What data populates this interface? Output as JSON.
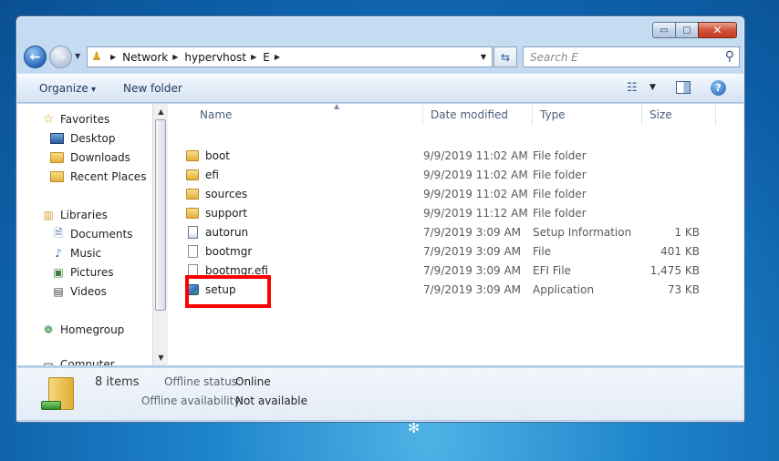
{
  "window": {
    "caption_buttons": {
      "minimize": "▭",
      "maximize": "▢",
      "close": "✕"
    }
  },
  "nav": {
    "back_glyph": "←",
    "forward_glyph": "→",
    "breadcrumbs": [
      "Network",
      "hypervhost",
      "E"
    ],
    "refresh_glyph": "⇆",
    "search_placeholder": "Search E"
  },
  "toolbar": {
    "organize_label": "Organize",
    "new_folder_label": "New folder",
    "views_icon": "views-icon",
    "preview_icon": "preview-pane-icon",
    "help_glyph": "?"
  },
  "sidebar": {
    "favorites": {
      "label": "Favorites",
      "icon": "star-icon"
    },
    "favorite_items": [
      {
        "label": "Desktop",
        "icon": "desktop-icon"
      },
      {
        "label": "Downloads",
        "icon": "downloads-folder-icon"
      },
      {
        "label": "Recent Places",
        "icon": "recent-places-icon"
      }
    ],
    "libraries": {
      "label": "Libraries",
      "icon": "libraries-icon"
    },
    "library_items": [
      {
        "label": "Documents",
        "icon": "documents-icon",
        "glyph": "🗎"
      },
      {
        "label": "Music",
        "icon": "music-icon",
        "glyph": "♪"
      },
      {
        "label": "Pictures",
        "icon": "pictures-icon",
        "glyph": "▣"
      },
      {
        "label": "Videos",
        "icon": "videos-icon",
        "glyph": "▤"
      }
    ],
    "homegroup": {
      "label": "Homegroup",
      "icon": "homegroup-icon",
      "glyph": "❁"
    },
    "computer": {
      "label": "Computer",
      "icon": "computer-icon"
    }
  },
  "columns": {
    "name": "Name",
    "date": "Date modified",
    "type": "Type",
    "size": "Size"
  },
  "files": [
    {
      "name": "boot",
      "date": "9/9/2019 11:02 AM",
      "type": "File folder",
      "size": "",
      "icon": "folder"
    },
    {
      "name": "efi",
      "date": "9/9/2019 11:02 AM",
      "type": "File folder",
      "size": "",
      "icon": "folder"
    },
    {
      "name": "sources",
      "date": "9/9/2019 11:02 AM",
      "type": "File folder",
      "size": "",
      "icon": "folder"
    },
    {
      "name": "support",
      "date": "9/9/2019 11:12 AM",
      "type": "File folder",
      "size": "",
      "icon": "folder"
    },
    {
      "name": "autorun",
      "date": "7/9/2019 3:09 AM",
      "type": "Setup Information",
      "size": "1 KB",
      "icon": "inf"
    },
    {
      "name": "bootmgr",
      "date": "7/9/2019 3:09 AM",
      "type": "File",
      "size": "401 KB",
      "icon": "file"
    },
    {
      "name": "bootmgr.efi",
      "date": "7/9/2019 3:09 AM",
      "type": "EFI File",
      "size": "1,475 KB",
      "icon": "file"
    },
    {
      "name": "setup",
      "date": "7/9/2019 3:09 AM",
      "type": "Application",
      "size": "73 KB",
      "icon": "app"
    }
  ],
  "highlight_color": "#ff0000",
  "details": {
    "count": "8 items",
    "offline_status_label": "Offline status:",
    "offline_status_value": "Online",
    "offline_availability_label": "Offline availability:",
    "offline_availability_value": "Not available"
  },
  "colors": {
    "accent": "#1e395b",
    "window_frame": "#b8d2ee",
    "close_button": "#c03a1f"
  }
}
